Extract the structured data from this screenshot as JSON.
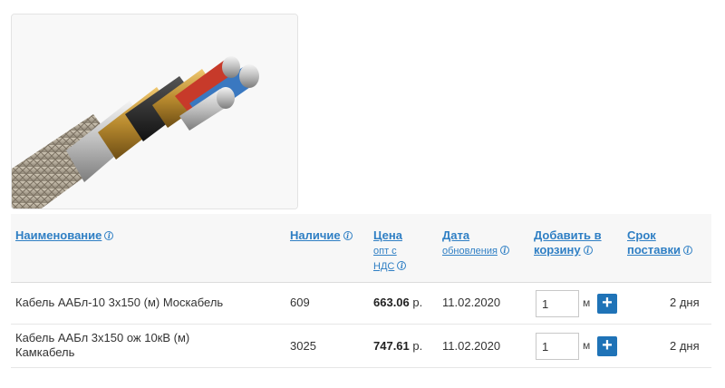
{
  "product": {
    "image_alt": "Кабель ААБл"
  },
  "table": {
    "headers": {
      "name": "Наименование",
      "stock": "Наличие",
      "price": "Цена",
      "price_sub": "опт с НДС",
      "date": "Дата",
      "date_sub": "обновления",
      "cart": "Добавить в корзину",
      "delivery": "Срок поставки"
    },
    "rows": [
      {
        "name": "Кабель ААБл-10 3х150 (м) Москабель",
        "stock": "609",
        "price": "663.06",
        "currency": "р.",
        "date": "11.02.2020",
        "qty": "1",
        "unit": "м",
        "delivery": "2 дня"
      },
      {
        "name": "Кабель ААБл 3х150 ож 10кВ (м) Камкабель",
        "stock": "3025",
        "price": "747.61",
        "currency": "р.",
        "date": "11.02.2020",
        "qty": "1",
        "unit": "м",
        "delivery": "2 дня"
      }
    ],
    "info_glyph": "i",
    "add_glyph": "+"
  },
  "colors": {
    "link": "#2f7fc4",
    "button": "#1f73b7"
  }
}
